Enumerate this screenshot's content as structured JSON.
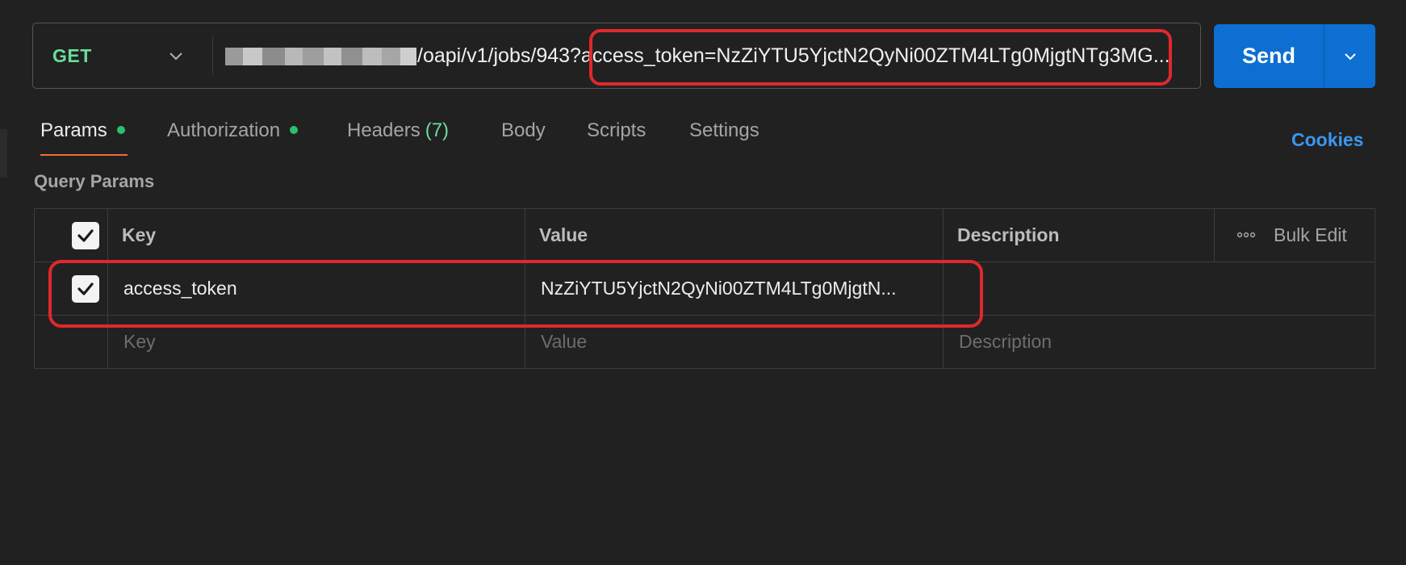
{
  "request": {
    "method": "GET",
    "url_visible": "/oapi/v1/jobs/943?access_token=NzZiYTU5YjctN2QyNi00ZTM4LTg0MjgtNTg3MG..."
  },
  "send": {
    "label": "Send"
  },
  "tabs": [
    {
      "label": "Params",
      "dot": true,
      "active": true
    },
    {
      "label": "Authorization",
      "dot": true,
      "active": false
    },
    {
      "label": "Headers",
      "count": "(7)",
      "active": false
    },
    {
      "label": "Body",
      "active": false
    },
    {
      "label": "Scripts",
      "active": false
    },
    {
      "label": "Settings",
      "active": false
    }
  ],
  "cookies_label": "Cookies",
  "query_params": {
    "title": "Query Params",
    "headers": {
      "key": "Key",
      "value": "Value",
      "description": "Description",
      "bulk_edit": "Bulk Edit"
    },
    "rows": [
      {
        "checked": true,
        "key": "access_token",
        "value": "NzZiYTU5YjctN2QyNi00ZTM4LTg0MjgtN...",
        "description": ""
      }
    ],
    "placeholder": {
      "key": "Key",
      "value": "Value",
      "description": "Description"
    }
  },
  "colors": {
    "background": "#212121",
    "method_green": "#6bdd9a",
    "send_blue": "#0d6fd1",
    "active_tab_underline": "#f26b3a",
    "status_dot": "#2bc06b",
    "cookies_link": "#3a97f0",
    "highlight_red": "#e0282c"
  },
  "icons": {
    "method_dropdown": "chevron-down-icon",
    "send_dropdown": "chevron-down-icon",
    "checkbox": "check-icon",
    "more": "more-horizontal-icon"
  }
}
